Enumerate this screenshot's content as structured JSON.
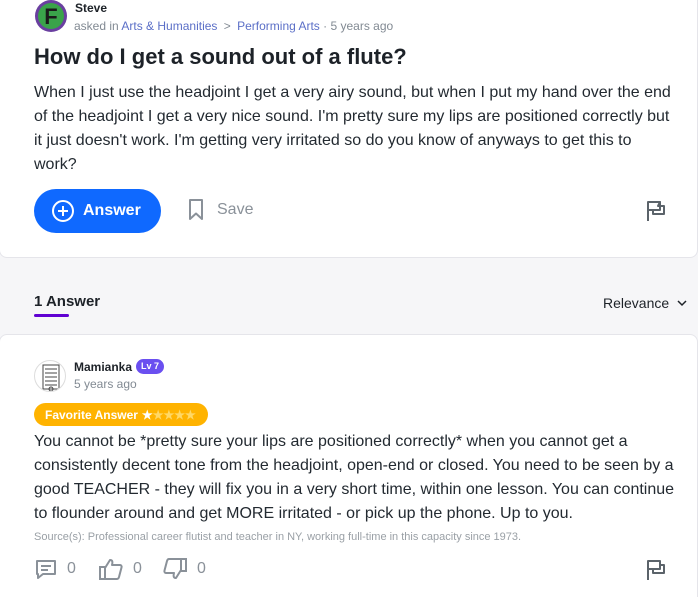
{
  "question": {
    "user_name": "Steve",
    "avatar_letter": "F",
    "asked_in_label": "asked in",
    "category": "Arts & Humanities",
    "subcategory": "Performing Arts",
    "breadcrumb_sep": ">",
    "age": "5 years ago",
    "title": "How do I get a sound out of a flute?",
    "body": "When I just use the headjoint I get a very airy  sound, but when I put my hand over the end of the headjoint I get a very nice sound. I'm pretty sure my lips are positioned correctly but it just doesn't work. I'm getting very irritated so do you know of anyways to get this to work?",
    "answer_button": "Answer",
    "save_label": "Save"
  },
  "answers_header": {
    "count_label": "1 Answer",
    "sort_label": "Relevance"
  },
  "answer": {
    "user_name": "Mamianka",
    "level_badge": "Lv 7",
    "age": "5 years ago",
    "favorite_label": "Favorite Answer",
    "favorite_stars": "★★★★★",
    "body": "You cannot be *pretty sure your lips are positioned correctly* when you cannot get a consistently decent tone from the headjoint, open-end or closed.  You need to be seen by a good TEACHER - they will fix you in a very short time, within one lesson.  You can continue to flounder around and get MORE irritated - or pick up the phone.  Up to you.",
    "source": "Source(s): Professional career flutist and teacher in NY, working full-time in this capacity since 1973.",
    "comments_count": "0",
    "thumbs_up_count": "0",
    "thumbs_down_count": "0"
  },
  "colors": {
    "answer_button": "#0f69ff",
    "favorite_badge": "#ffb300",
    "level_badge": "#6a4ff0",
    "tab_underline": "#6001d2",
    "link": "#5b6fc7"
  }
}
